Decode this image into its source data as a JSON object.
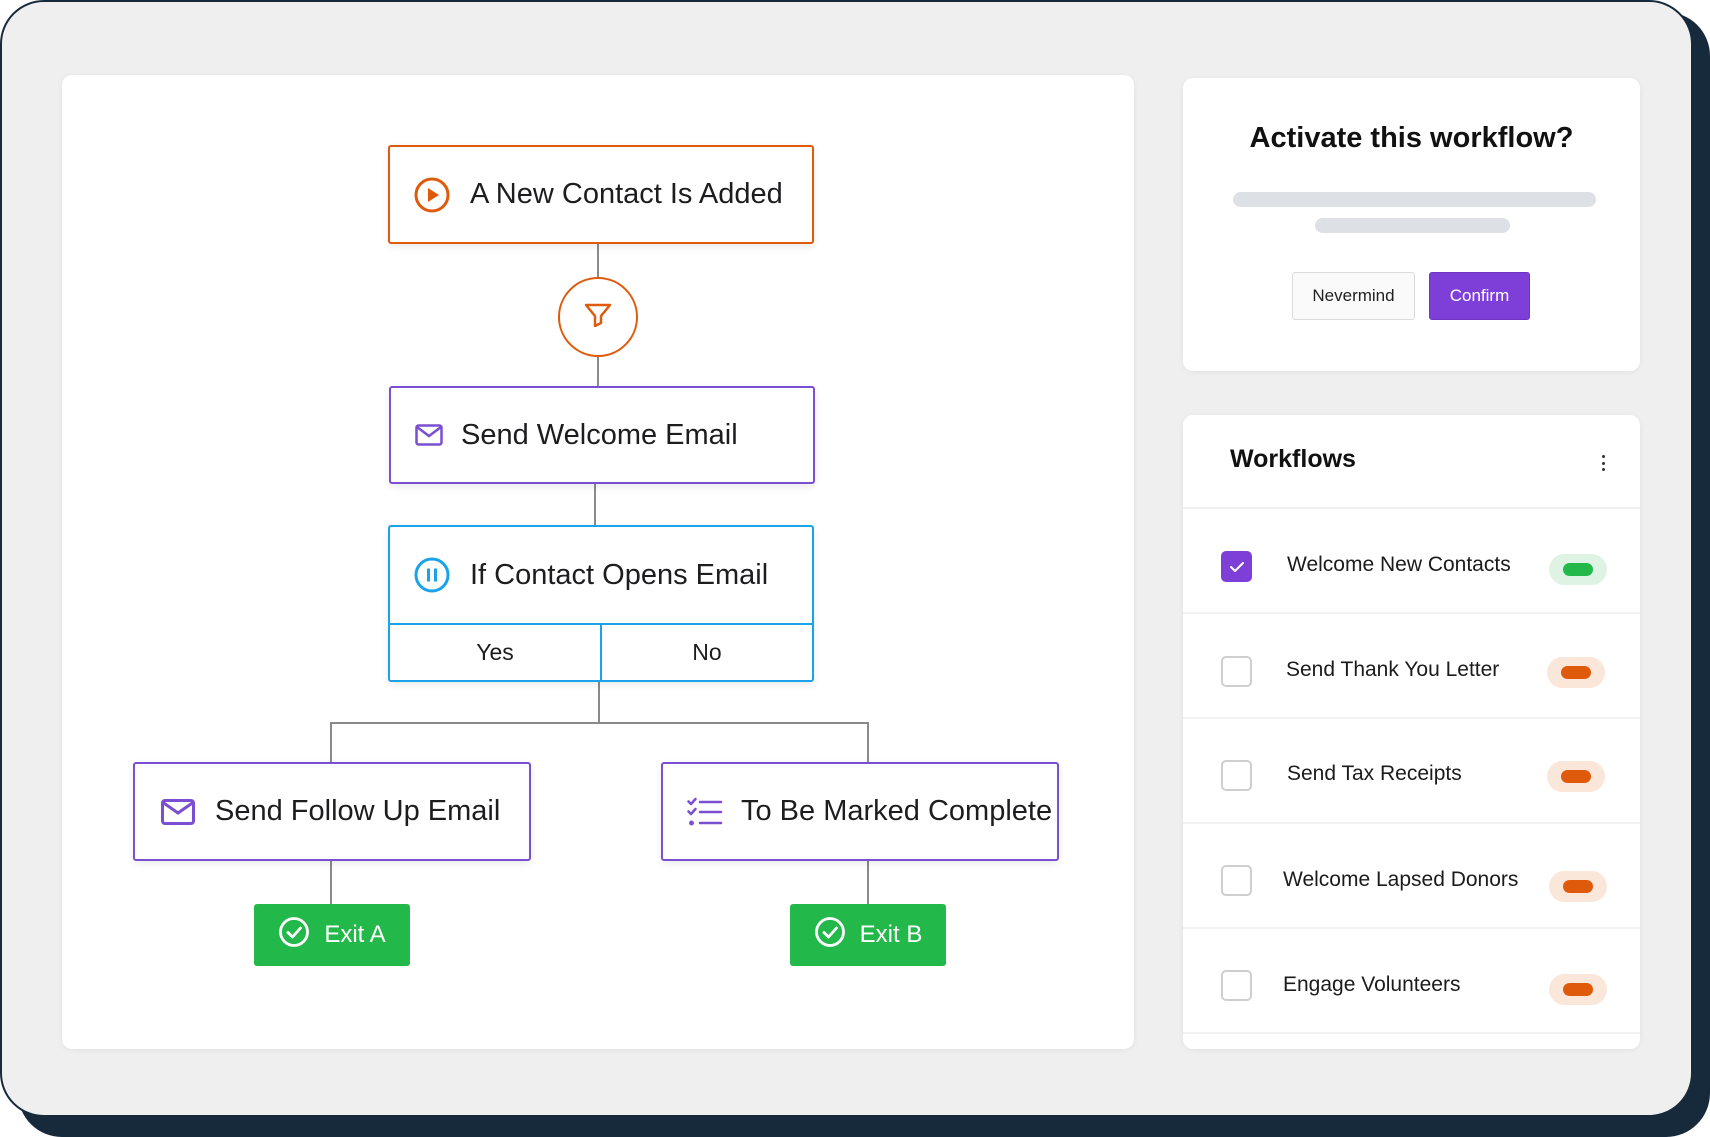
{
  "colors": {
    "trigger_orange": "#e05a0c",
    "action_purple": "#7b4fd1",
    "condition_blue": "#1aa3ea",
    "exit_green": "#22b84a",
    "primary_button": "#7e3fd8",
    "toggle_on": "#22b84a",
    "toggle_off": "#e05a0c"
  },
  "flow": {
    "trigger": {
      "label": "A New Contact Is Added",
      "icon": "play-circle-icon"
    },
    "filter": {
      "icon": "filter-icon"
    },
    "send_welcome": {
      "label": "Send Welcome Email",
      "icon": "envelope-icon"
    },
    "condition": {
      "label": "If Contact Opens Email",
      "icon": "pause-circle-icon",
      "yes": "Yes",
      "no": "No"
    },
    "follow_up": {
      "label": "Send Follow Up Email",
      "icon": "envelope-icon"
    },
    "mark_complete": {
      "label": "To Be Marked Complete",
      "icon": "checklist-icon"
    },
    "exit_a": {
      "label": "Exit A",
      "icon": "check-circle-icon"
    },
    "exit_b": {
      "label": "Exit B",
      "icon": "check-circle-icon"
    }
  },
  "modal": {
    "title": "Activate this workflow?",
    "cancel_label": "Nevermind",
    "confirm_label": "Confirm"
  },
  "workflows": {
    "title": "Workflows",
    "menu_icon": "kebab-menu-icon",
    "items": [
      {
        "label": "Welcome New Contacts",
        "checked": true,
        "active": true
      },
      {
        "label": "Send Thank You Letter",
        "checked": false,
        "active": false
      },
      {
        "label": "Send Tax Receipts",
        "checked": false,
        "active": false
      },
      {
        "label": "Welcome Lapsed Donors",
        "checked": false,
        "active": false
      },
      {
        "label": "Engage Volunteers",
        "checked": false,
        "active": false
      }
    ]
  }
}
